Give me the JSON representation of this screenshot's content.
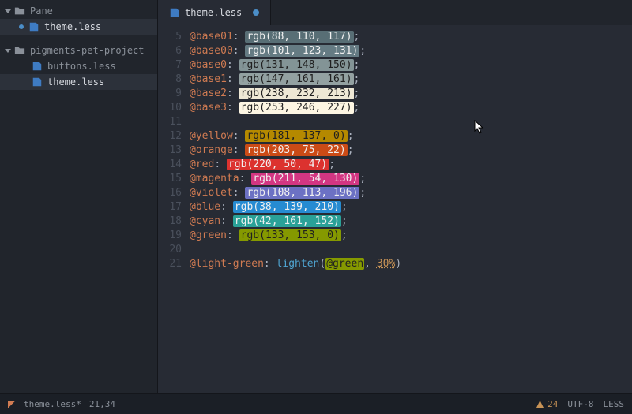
{
  "sidebar": {
    "root": {
      "label": "Pane"
    },
    "items": [
      {
        "label": "theme.less",
        "modified": true,
        "selected": true
      },
      {
        "label": "pigments-pet-project",
        "folder": true
      },
      {
        "label": "buttons.less"
      },
      {
        "label": "theme.less"
      }
    ]
  },
  "tab": {
    "label": "theme.less"
  },
  "code": {
    "lines": [
      {
        "n": 5,
        "var": "@base01",
        "fn": "rgb",
        "args": "88, 110, 117",
        "swatch": "#586e75",
        "light": true
      },
      {
        "n": 6,
        "var": "@base00",
        "fn": "rgb",
        "args": "101, 123, 131",
        "swatch": "#657b83",
        "light": true
      },
      {
        "n": 7,
        "var": "@base0",
        "fn": "rgb",
        "args": "131, 148, 150",
        "swatch": "#839496",
        "light": false
      },
      {
        "n": 8,
        "var": "@base1",
        "fn": "rgb",
        "args": "147, 161, 161",
        "swatch": "#93a1a1",
        "light": false
      },
      {
        "n": 9,
        "var": "@base2",
        "fn": "rgb",
        "args": "238, 232, 213",
        "swatch": "#eee8d5",
        "light": false
      },
      {
        "n": 10,
        "var": "@base3",
        "fn": "rgb",
        "args": "253, 246, 227",
        "swatch": "#fdf6e3",
        "light": false
      },
      {
        "n": 11
      },
      {
        "n": 12,
        "var": "@yellow",
        "fn": "rgb",
        "args": "181, 137, 0",
        "swatch": "#b58900",
        "light": false
      },
      {
        "n": 13,
        "var": "@orange",
        "fn": "rgb",
        "args": "203, 75, 22",
        "swatch": "#cb4b16",
        "light": true
      },
      {
        "n": 14,
        "var": "@red",
        "fn": "rgb",
        "args": "220, 50, 47",
        "swatch": "#dc322f",
        "light": true
      },
      {
        "n": 15,
        "var": "@magenta",
        "fn": "rgb",
        "args": "211, 54, 130",
        "swatch": "#d33682",
        "light": true
      },
      {
        "n": 16,
        "var": "@violet",
        "fn": "rgb",
        "args": "108, 113, 196",
        "swatch": "#6c71c4",
        "light": true
      },
      {
        "n": 17,
        "var": "@blue",
        "fn": "rgb",
        "args": "38, 139, 210",
        "swatch": "#268bd2",
        "light": true
      },
      {
        "n": 18,
        "var": "@cyan",
        "fn": "rgb",
        "args": "42, 161, 152",
        "swatch": "#2aa198",
        "light": true
      },
      {
        "n": 19,
        "var": "@green",
        "fn": "rgb",
        "args": "133, 153, 0",
        "swatch": "#859900",
        "light": false
      },
      {
        "n": 20
      },
      {
        "n": 21,
        "special": true,
        "var": "@light-green",
        "fn": "lighten",
        "ref": "@green",
        "pct": "30%"
      }
    ]
  },
  "status": {
    "filename": "theme.less*",
    "position": "21,34",
    "warnings": "24",
    "encoding": "UTF-8",
    "grammar": "LESS"
  }
}
